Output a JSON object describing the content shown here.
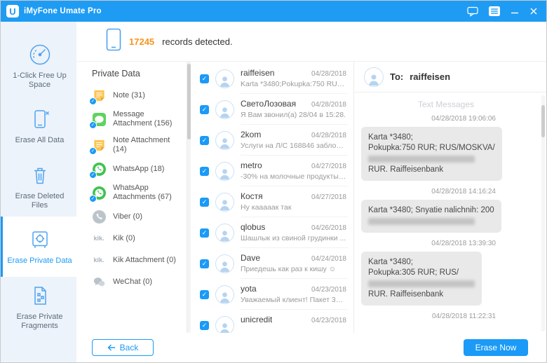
{
  "colors": {
    "titlebar": "#1E9CF4",
    "accent": "#1B9AF7",
    "orange": "#F7941D",
    "sidebar_bg": "#EDF3FA"
  },
  "titlebar": {
    "logo_letter": "U",
    "app_title": "iMyFone Umate Pro"
  },
  "sidebar": {
    "items": [
      {
        "label": "1-Click Free Up Space",
        "active": false
      },
      {
        "label": "Erase All Data",
        "active": false
      },
      {
        "label": "Erase Deleted Files",
        "active": false
      },
      {
        "label": "Erase Private Data",
        "active": true
      },
      {
        "label": "Erase Private Fragments",
        "active": false
      }
    ]
  },
  "header": {
    "count": "17245",
    "label": "records detected."
  },
  "private_data": {
    "title": "Private Data",
    "items": [
      {
        "label": "Note (31)",
        "icon": "note",
        "checked": true
      },
      {
        "label": "Message Attachment (156)",
        "icon": "message",
        "checked": true
      },
      {
        "label": "Note Attachment (14)",
        "icon": "note",
        "checked": true
      },
      {
        "label": "WhatsApp (18)",
        "icon": "whatsapp",
        "checked": true
      },
      {
        "label": "WhatsApp Attachments (67)",
        "icon": "whatsapp",
        "checked": true
      },
      {
        "label": "Viber (0)",
        "icon": "viber",
        "checked": false
      },
      {
        "label": "Kik (0)",
        "icon": "kik",
        "checked": false
      },
      {
        "label": "Kik Attachment (0)",
        "icon": "kik",
        "checked": false
      },
      {
        "label": "WeChat (0)",
        "icon": "wechat",
        "checked": false
      }
    ]
  },
  "conversations": [
    {
      "name": "raiffeisen",
      "date": "04/28/2018",
      "preview": "Karta *3480;Pokupka:750 RUR; R...",
      "checked": true
    },
    {
      "name": "СветоЛозовая",
      "date": "04/28/2018",
      "preview": "Я Вам звонил(а) 28/04 в 15:28.",
      "checked": true
    },
    {
      "name": "2kom",
      "date": "04/28/2018",
      "preview": "Услуги на Л/С 168846 заблоки...",
      "checked": true
    },
    {
      "name": "metro",
      "date": "04/27/2018",
      "preview": "-30% на молочные продукты ...",
      "checked": true
    },
    {
      "name": "Костя",
      "date": "04/27/2018",
      "preview": "Ну кааааак так",
      "checked": true
    },
    {
      "name": "qlobus",
      "date": "04/26/2018",
      "preview": "Шашлык из свиной грудинки ...",
      "checked": true
    },
    {
      "name": "Dave",
      "date": "04/24/2018",
      "preview": "Приедешь как раз к кишу ☺",
      "checked": true
    },
    {
      "name": "yota",
      "date": "04/23/2018",
      "preview": "Уважаемый клиент! Пакет 300 ...",
      "checked": true
    },
    {
      "name": "unicredit",
      "date": "04/23/2018",
      "preview": "",
      "checked": true
    }
  ],
  "detail": {
    "to_label": "To:",
    "recipient": "raiffeisen",
    "section_title": "Text Messages",
    "messages": [
      {
        "timestamp": "04/28/2018 19:06:06",
        "lines": [
          "Karta *3480;",
          "Pokupka:750 RUR; RUS/MOSKVA/",
          "",
          "RUR. Raiffeisenbank"
        ]
      },
      {
        "timestamp": "04/28/2018 14:16:24",
        "lines": [
          "Karta *3480; Snyatie nalichnih: 200",
          ""
        ]
      },
      {
        "timestamp": "04/28/2018 13:39:30",
        "lines": [
          "Karta *3480;",
          "Pokupka:305 RUR; RUS/",
          "",
          "RUR. Raiffeisenbank"
        ]
      },
      {
        "timestamp": "04/28/2018 11:22:31",
        "lines": []
      }
    ]
  },
  "footer": {
    "back": "Back",
    "erase": "Erase Now"
  }
}
